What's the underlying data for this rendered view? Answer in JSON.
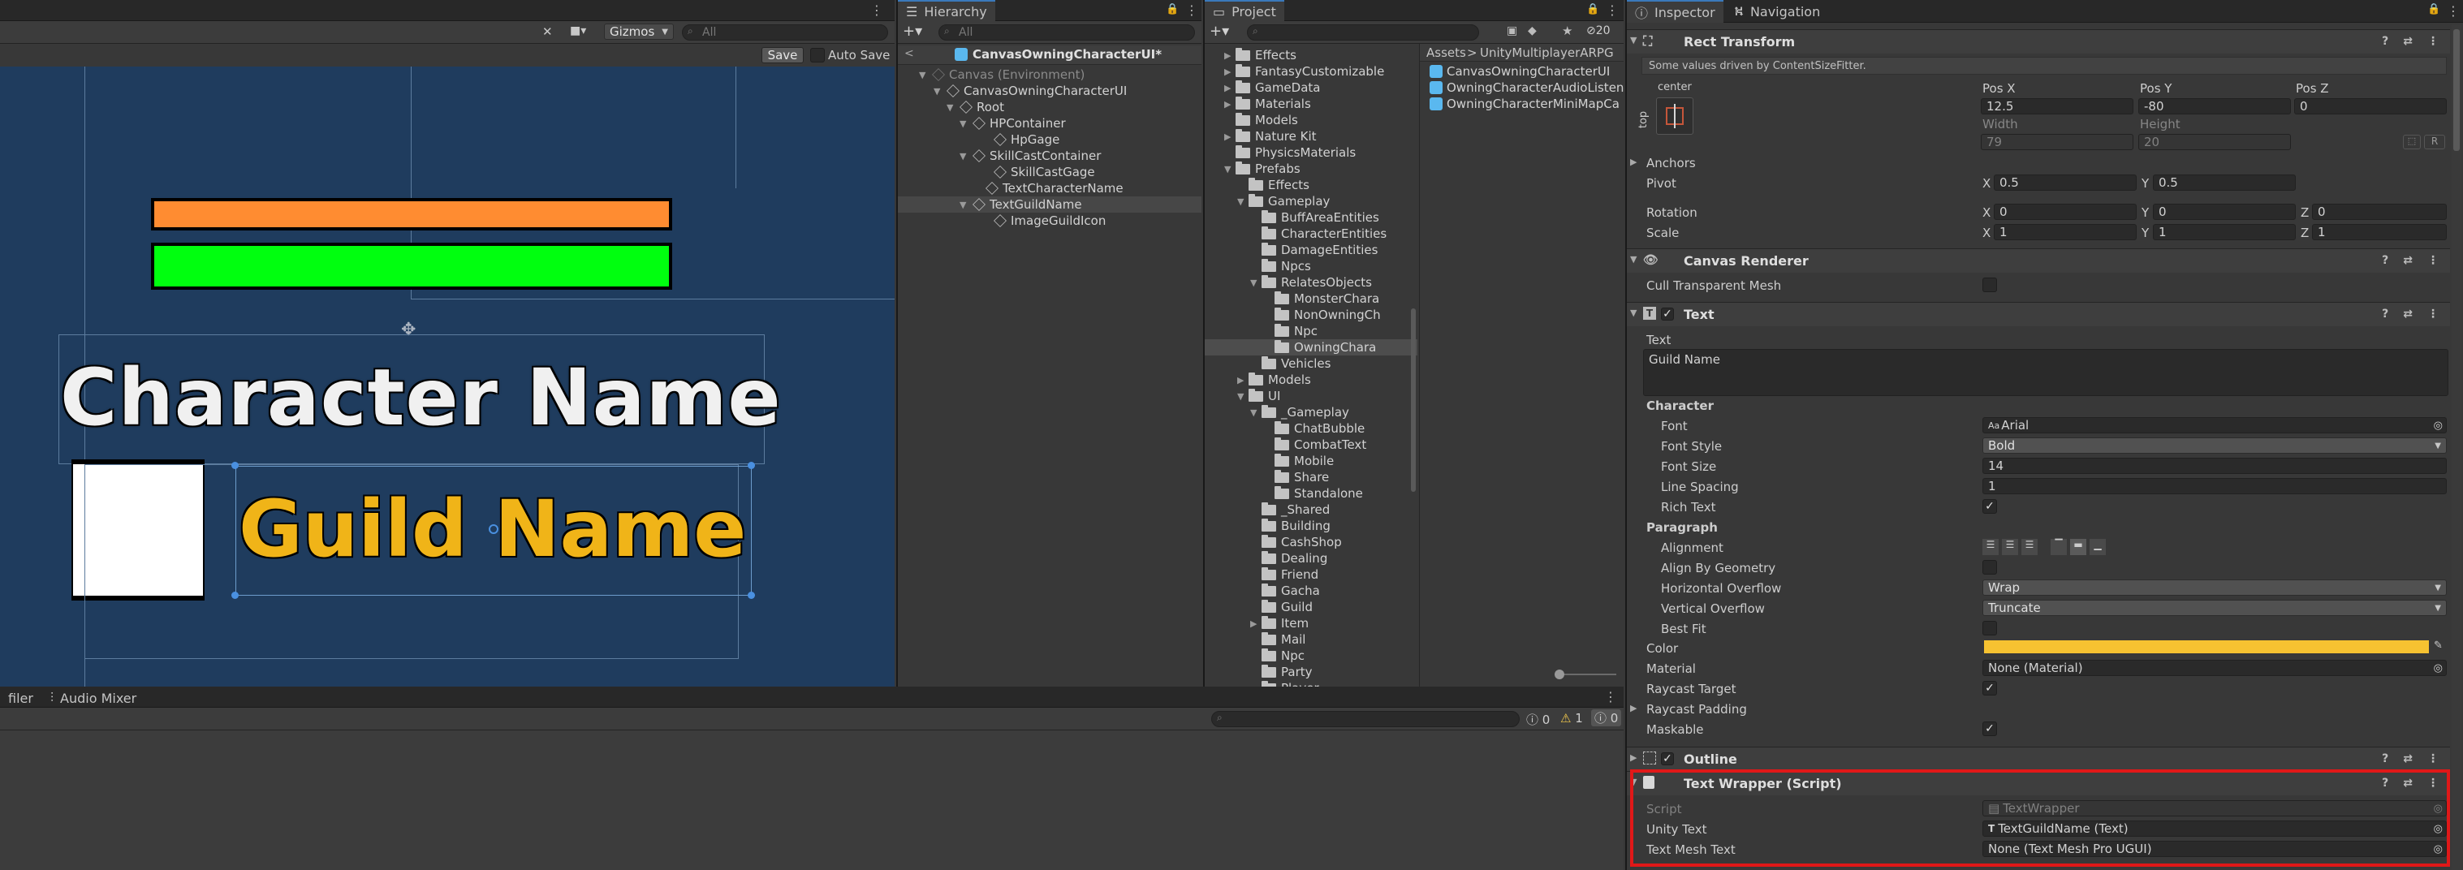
{
  "scene": {
    "toolbar": {
      "gizmos_label": "Gizmos",
      "search_placeholder": "All"
    },
    "save_label": "Save",
    "autosave_label": "Auto Save",
    "character_name": "Character Name",
    "guild_name": "Guild Name",
    "colors": {
      "bg": "#1e3c5e",
      "hp_bar": "#ff8c31",
      "skill_bar": "#00ff0f",
      "guild_text": "#f0b418"
    }
  },
  "bottom": {
    "tab_profiler": "filer",
    "tab_audio_mixer": "Audio Mixer",
    "counts": {
      "info": "0",
      "warn": "1",
      "error": "0"
    }
  },
  "hierarchy": {
    "title": "Hierarchy",
    "search_placeholder": "All",
    "scene_title": "CanvasOwningCharacterUI*",
    "items": [
      {
        "label": "Canvas (Environment)",
        "arrow": "▼",
        "dim": true
      },
      {
        "label": "CanvasOwningCharacterUI",
        "arrow": "▼"
      },
      {
        "label": "Root",
        "arrow": "▼"
      },
      {
        "label": "HPContainer",
        "arrow": "▼"
      },
      {
        "label": "HpGage",
        "arrow": ""
      },
      {
        "label": "SkillCastContainer",
        "arrow": "▼"
      },
      {
        "label": "SkillCastGage",
        "arrow": ""
      },
      {
        "label": "TextCharacterName",
        "arrow": ""
      },
      {
        "label": "TextGuildName",
        "arrow": "▼",
        "selected": true
      },
      {
        "label": "ImageGuildIcon",
        "arrow": ""
      }
    ]
  },
  "project": {
    "title": "Project",
    "badge": "20",
    "breadcrumb": [
      "Assets",
      "UnityMultiplayerARPG"
    ],
    "tree": [
      {
        "label": "Effects",
        "arrow": "▶"
      },
      {
        "label": "FantasyCustomizable",
        "arrow": "▶"
      },
      {
        "label": "GameData",
        "arrow": "▶"
      },
      {
        "label": "Materials",
        "arrow": "▶"
      },
      {
        "label": "Models",
        "arrow": ""
      },
      {
        "label": "Nature Kit",
        "arrow": "▶"
      },
      {
        "label": "PhysicsMaterials",
        "arrow": ""
      },
      {
        "label": "Prefabs",
        "arrow": "▼"
      },
      {
        "label": "Effects",
        "arrow": ""
      },
      {
        "label": "Gameplay",
        "arrow": "▼"
      },
      {
        "label": "BuffAreaEntities",
        "arrow": ""
      },
      {
        "label": "CharacterEntities",
        "arrow": ""
      },
      {
        "label": "DamageEntities",
        "arrow": ""
      },
      {
        "label": "Npcs",
        "arrow": ""
      },
      {
        "label": "RelatesObjects",
        "arrow": "▼"
      },
      {
        "label": "MonsterChara",
        "arrow": ""
      },
      {
        "label": "NonOwningCh",
        "arrow": ""
      },
      {
        "label": "Npc",
        "arrow": ""
      },
      {
        "label": "OwningChara",
        "arrow": "",
        "selected": true
      },
      {
        "label": "Vehicles",
        "arrow": ""
      },
      {
        "label": "Models",
        "arrow": "▶"
      },
      {
        "label": "UI",
        "arrow": "▼"
      },
      {
        "label": "_Gameplay",
        "arrow": "▼"
      },
      {
        "label": "ChatBubble",
        "arrow": ""
      },
      {
        "label": "CombatText",
        "arrow": ""
      },
      {
        "label": "Mobile",
        "arrow": ""
      },
      {
        "label": "Share",
        "arrow": ""
      },
      {
        "label": "Standalone",
        "arrow": ""
      },
      {
        "label": "_Shared",
        "arrow": ""
      },
      {
        "label": "Building",
        "arrow": ""
      },
      {
        "label": "CashShop",
        "arrow": ""
      },
      {
        "label": "Dealing",
        "arrow": ""
      },
      {
        "label": "Friend",
        "arrow": ""
      },
      {
        "label": "Gacha",
        "arrow": ""
      },
      {
        "label": "Guild",
        "arrow": ""
      },
      {
        "label": "Item",
        "arrow": "▶"
      },
      {
        "label": "Mail",
        "arrow": ""
      },
      {
        "label": "Npc",
        "arrow": ""
      },
      {
        "label": "Party",
        "arrow": ""
      },
      {
        "label": "Player",
        "arrow": ""
      }
    ],
    "files": [
      "CanvasOwningCharacterUI",
      "OwningCharacterAudioListen",
      "OwningCharacterMiniMapCa"
    ]
  },
  "inspector": {
    "tab_inspector": "Inspector",
    "tab_navigation": "Navigation",
    "rect": {
      "title": "Rect Transform",
      "note": "Some values driven by ContentSizeFitter.",
      "anchor_h": "center",
      "anchor_v": "top",
      "posx_label": "Pos X",
      "posy_label": "Pos Y",
      "posz_label": "Pos Z",
      "posx": "12.5",
      "posy": "-80",
      "posz": "0",
      "width_label": "Width",
      "height_label": "Height",
      "width": "79",
      "height": "20",
      "r_label": "R",
      "anchors_label": "Anchors",
      "pivot_label": "Pivot",
      "pivot_x": "0.5",
      "pivot_y": "0.5",
      "rotation_label": "Rotation",
      "rot_x": "0",
      "rot_y": "0",
      "rot_z": "0",
      "scale_label": "Scale",
      "scale_x": "1",
      "scale_y": "1",
      "scale_z": "1",
      "x": "X",
      "y": "Y",
      "z": "Z"
    },
    "canvas_renderer": {
      "title": "Canvas Renderer",
      "cull_label": "Cull Transparent Mesh"
    },
    "text": {
      "title": "Text",
      "text_label": "Text",
      "text_value": "Guild Name",
      "character_label": "Character",
      "font_label": "Font",
      "font_value": "Arial",
      "font_style_label": "Font Style",
      "font_style_value": "Bold",
      "font_size_label": "Font Size",
      "font_size_value": "14",
      "line_spacing_label": "Line Spacing",
      "line_spacing_value": "1",
      "rich_text_label": "Rich Text",
      "paragraph_label": "Paragraph",
      "alignment_label": "Alignment",
      "align_geometry_label": "Align By Geometry",
      "h_overflow_label": "Horizontal Overflow",
      "h_overflow_value": "Wrap",
      "v_overflow_label": "Vertical Overflow",
      "v_overflow_value": "Truncate",
      "best_fit_label": "Best Fit",
      "color_label": "Color",
      "color_value": "#f6c231",
      "material_label": "Material",
      "material_value": "None (Material)",
      "raycast_target_label": "Raycast Target",
      "raycast_padding_label": "Raycast Padding",
      "maskable_label": "Maskable"
    },
    "outline": {
      "title": "Outline"
    },
    "wrapper": {
      "title": "Text Wrapper (Script)",
      "script_label": "Script",
      "script_value": "TextWrapper",
      "unity_text_label": "Unity Text",
      "unity_text_value": "TextGuildName (Text)",
      "tmp_label": "Text Mesh Text",
      "tmp_value": "None (Text Mesh Pro UGUI)",
      "highlight": "#e01818"
    }
  }
}
